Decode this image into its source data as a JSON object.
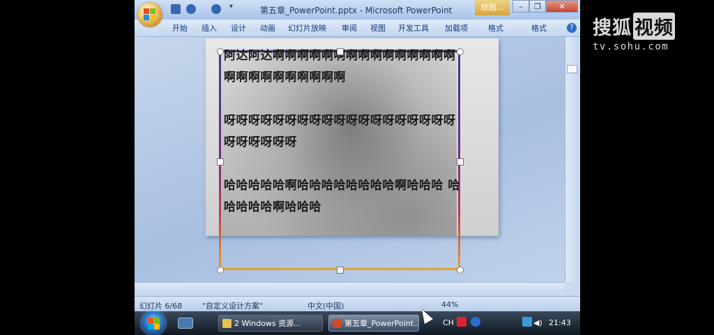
{
  "window": {
    "title": "第五章_PowerPoint.pptx - Microsoft PowerPoint",
    "context_tab": "绘图...",
    "qat_more": "▾"
  },
  "ribbon": {
    "tabs": [
      "开始",
      "插入",
      "设计",
      "动画",
      "幻灯片放映",
      "审阅",
      "视图",
      "开发工具",
      "加载项",
      "格式",
      "格式"
    ],
    "help": "?"
  },
  "slide": {
    "paragraphs": [
      "        阿达阿达啊啊啊啊啊啊啊啊啊啊啊啊啊啊啊啊啊啊啊啊啊啊啊啊啊",
      "        呀呀呀呀呀呀呀呀呀呀呀呀呀呀呀呀呀呀呀呀呀呀呀呀呀",
      "        哈哈哈哈哈啊哈哈哈哈哈哈哈哈啊哈哈哈  哈哈哈哈哈啊哈哈哈"
    ]
  },
  "statusbar": {
    "slide_count": "幻灯片 6/68",
    "theme": "\"自定义设计方案\"",
    "language": "中文(中国)",
    "zoom": "44%"
  },
  "taskbar": {
    "explorer": "2 Windows 资源...",
    "powerpoint": "第五章_PowerPoint...",
    "tray_lang": "CH",
    "time": "21:43"
  },
  "watermark": {
    "brand": "搜狐",
    "brand_box": "视频",
    "url": "tv.sohu.com"
  },
  "colors": {
    "textbox_border_top": "#3b3d86",
    "textbox_border_bottom": "#e6a12a",
    "ribbon_bg": "#dde9f8"
  }
}
